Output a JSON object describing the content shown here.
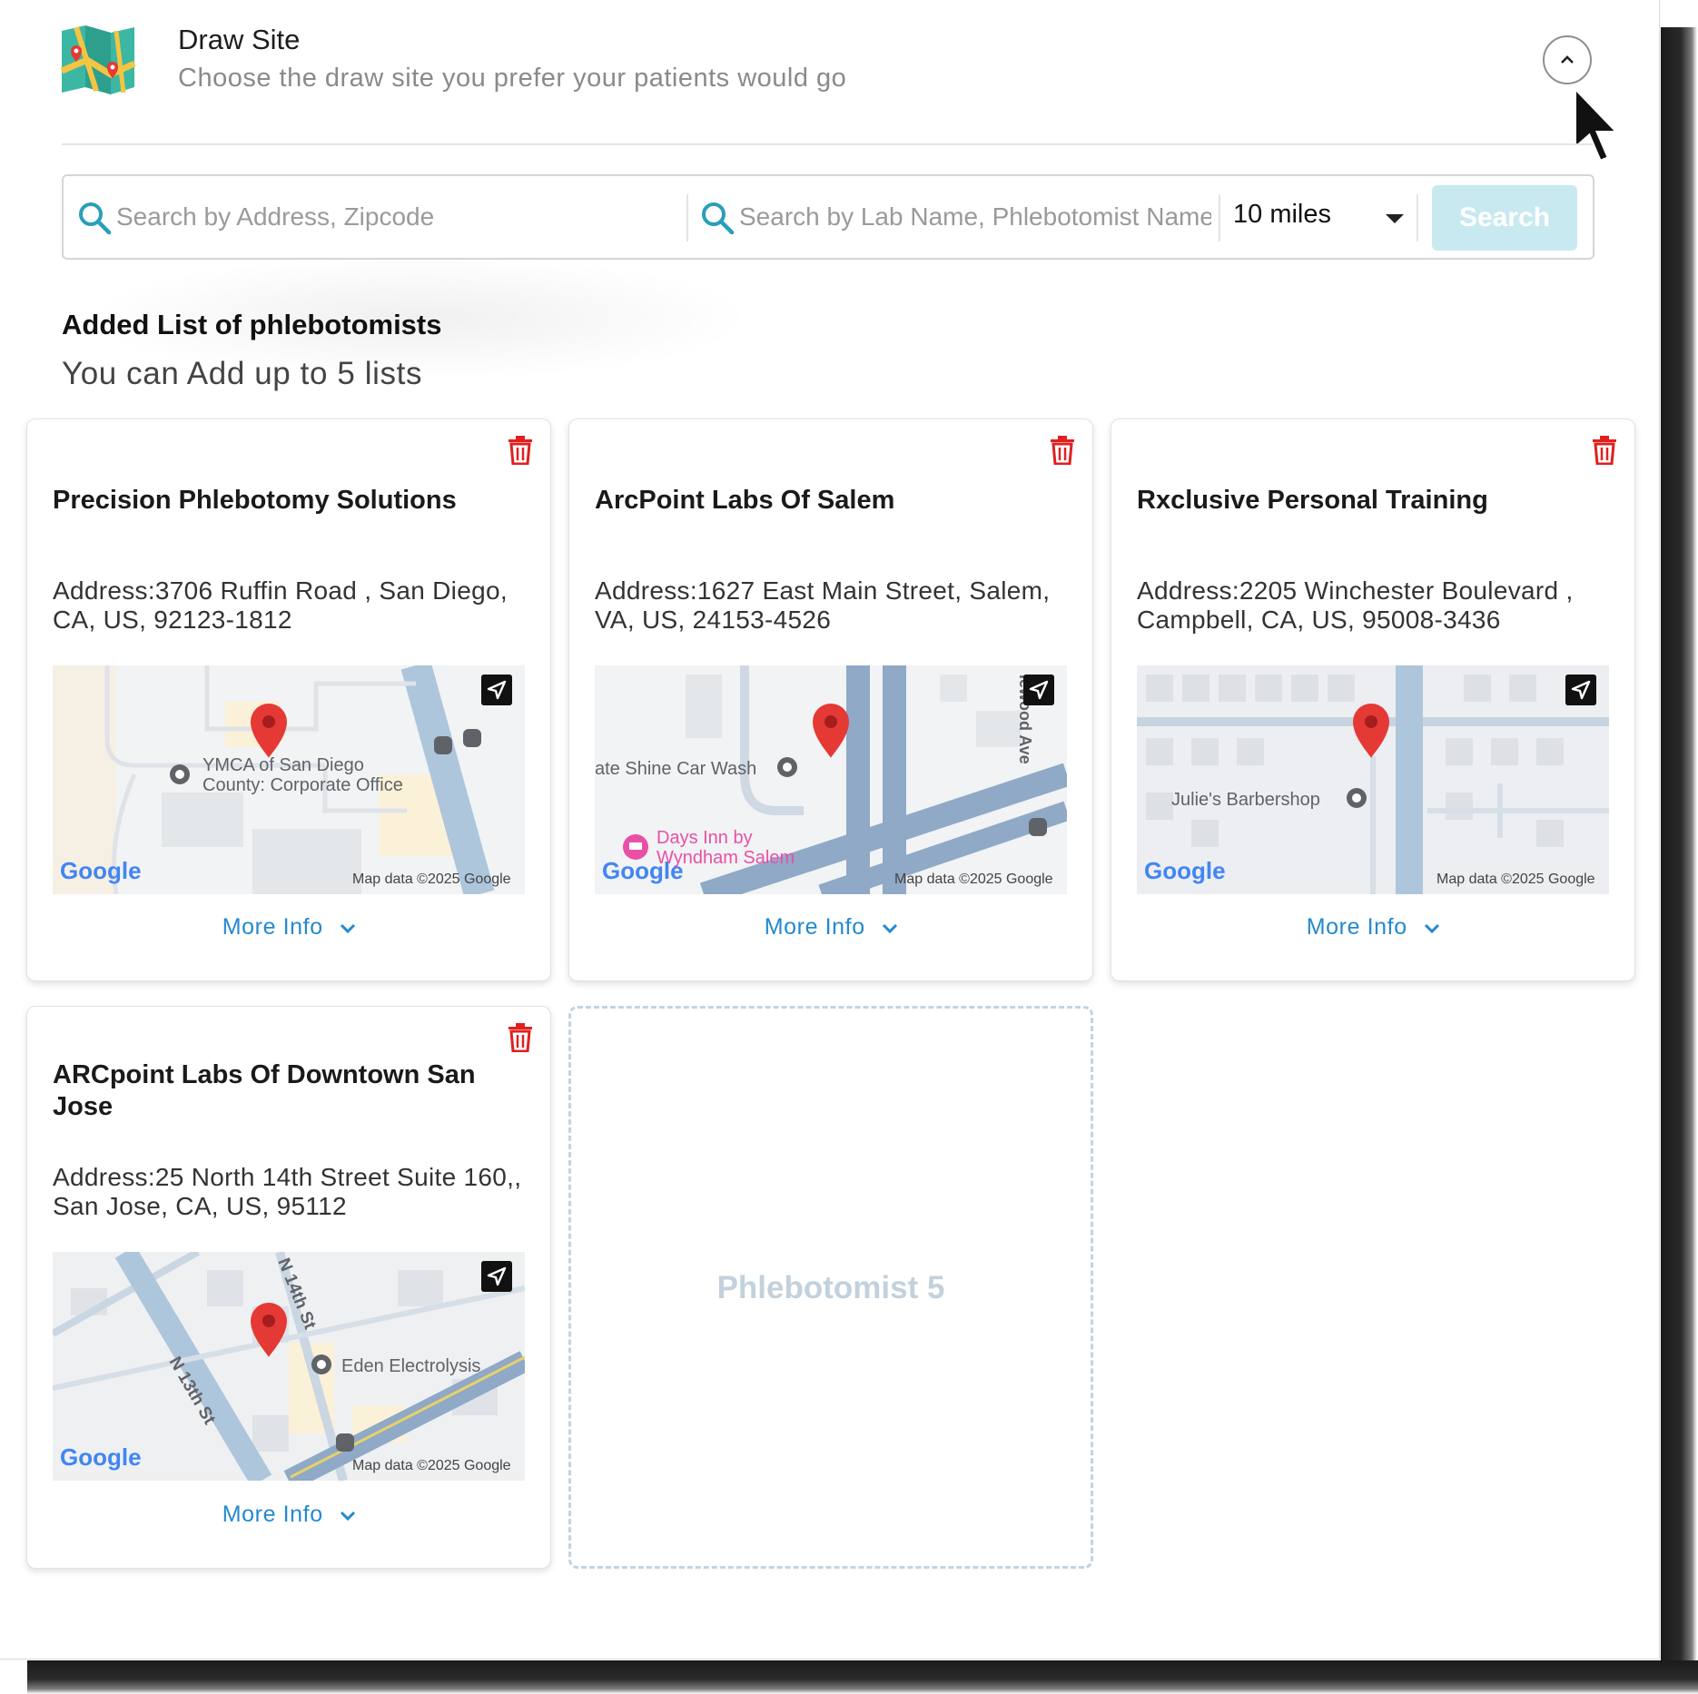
{
  "header": {
    "title": "Draw Site",
    "subtitle": "Choose the draw site you prefer your patients would go",
    "logo_icon": "map-icon",
    "collapse_icon": "chevron-up-icon"
  },
  "search": {
    "address_placeholder": "Search by Address, Zipcode",
    "lab_placeholder": "Search by Lab Name, Phlebotomist Name",
    "radius_selected": "10 miles",
    "button_label": "Search"
  },
  "section": {
    "title": "Added List of phlebotomists",
    "subtitle": "You can Add up to 5 lists"
  },
  "cards": [
    {
      "name": "Precision Phlebotomy Solutions",
      "address": "Address:3706 Ruffin Road , San Diego, CA, US, 92123-1812",
      "map_labels": [
        "YMCA of San Diego",
        "County: Corporate Office"
      ],
      "map_attribution": "Map data ©2025 Google",
      "map_logo": "Google",
      "more_info": "More Info"
    },
    {
      "name": "ArcPoint Labs Of Salem",
      "address": "Address:1627 East Main Street, Salem, VA, US, 24153-4526",
      "map_labels": [
        "ate Shine Car Wash",
        "Days Inn by",
        "Wyndham Salem",
        "lewood Ave"
      ],
      "map_attribution": "Map data ©2025 Google",
      "map_logo": "Google",
      "more_info": "More Info"
    },
    {
      "name": "Rxclusive Personal Training",
      "address": "Address:2205 Winchester Boulevard , Campbell, CA, US, 95008-3436",
      "map_labels": [
        "Julie's Barbershop"
      ],
      "map_attribution": "Map data ©2025 Google",
      "map_logo": "Google",
      "more_info": "More Info"
    },
    {
      "name": "ARCpoint Labs Of Downtown San Jose",
      "address": "Address:25 North 14th Street Suite 160,, San Jose, CA, US, 95112",
      "map_labels": [
        "N 14th St",
        "Eden Electrolysis",
        "N 13th St"
      ],
      "map_attribution": "Map data ©2025 Google",
      "map_logo": "Google",
      "more_info": "More Info"
    }
  ],
  "empty_slot": {
    "label": "Phlebotomist 5"
  },
  "colors": {
    "accent_link": "#2489d0",
    "delete": "#e02020",
    "search_button_disabled": "#c9e9f1",
    "pin": "#e53935"
  }
}
